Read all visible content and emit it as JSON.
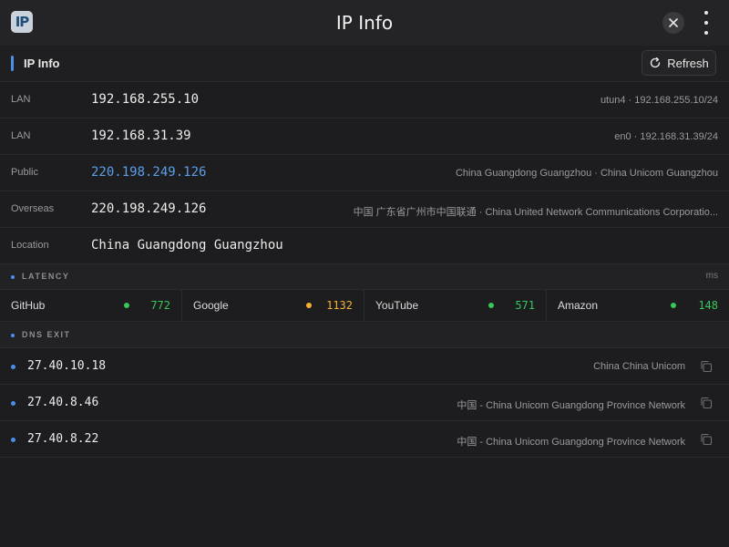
{
  "window": {
    "title": "IP Info",
    "app_icon_text": "IP"
  },
  "section": {
    "title": "IP Info",
    "refresh_label": "Refresh"
  },
  "rows": [
    {
      "label": "LAN",
      "value": "192.168.255.10",
      "detail": "utun4 · 192.168.255.10/24"
    },
    {
      "label": "LAN",
      "value": "192.168.31.39",
      "detail": "en0 · 192.168.31.39/24"
    },
    {
      "label": "Public",
      "value": "220.198.249.126",
      "detail": "China Guangdong Guangzhou · China Unicom Guangzhou"
    },
    {
      "label": "Overseas",
      "value": "220.198.249.126",
      "detail": "中国 广东省广州市中国联通 · China United Network Communications Corporatio..."
    },
    {
      "label": "Location",
      "value": "China Guangdong Guangzhou",
      "detail": ""
    }
  ],
  "latency": {
    "title": "LATENCY",
    "unit": "ms",
    "items": [
      {
        "name": "GitHub",
        "value": "772",
        "color": "#34c759"
      },
      {
        "name": "Google",
        "value": "1132",
        "color": "#f5b133"
      },
      {
        "name": "YouTube",
        "value": "571",
        "color": "#34c759"
      },
      {
        "name": "Amazon",
        "value": "148",
        "color": "#34c759"
      }
    ]
  },
  "dns": {
    "title": "DNS EXIT",
    "items": [
      {
        "ip": "27.40.10.18",
        "info": "China China Unicom"
      },
      {
        "ip": "27.40.8.46",
        "info": "中国 - China Unicom Guangdong Province Network"
      },
      {
        "ip": "27.40.8.22",
        "info": "中国 - China Unicom Guangdong Province Network"
      }
    ]
  },
  "colors": {
    "accent": "#4a8fe8",
    "link": "#5b9ee8",
    "good": "#34c759",
    "warn": "#f5b133"
  }
}
